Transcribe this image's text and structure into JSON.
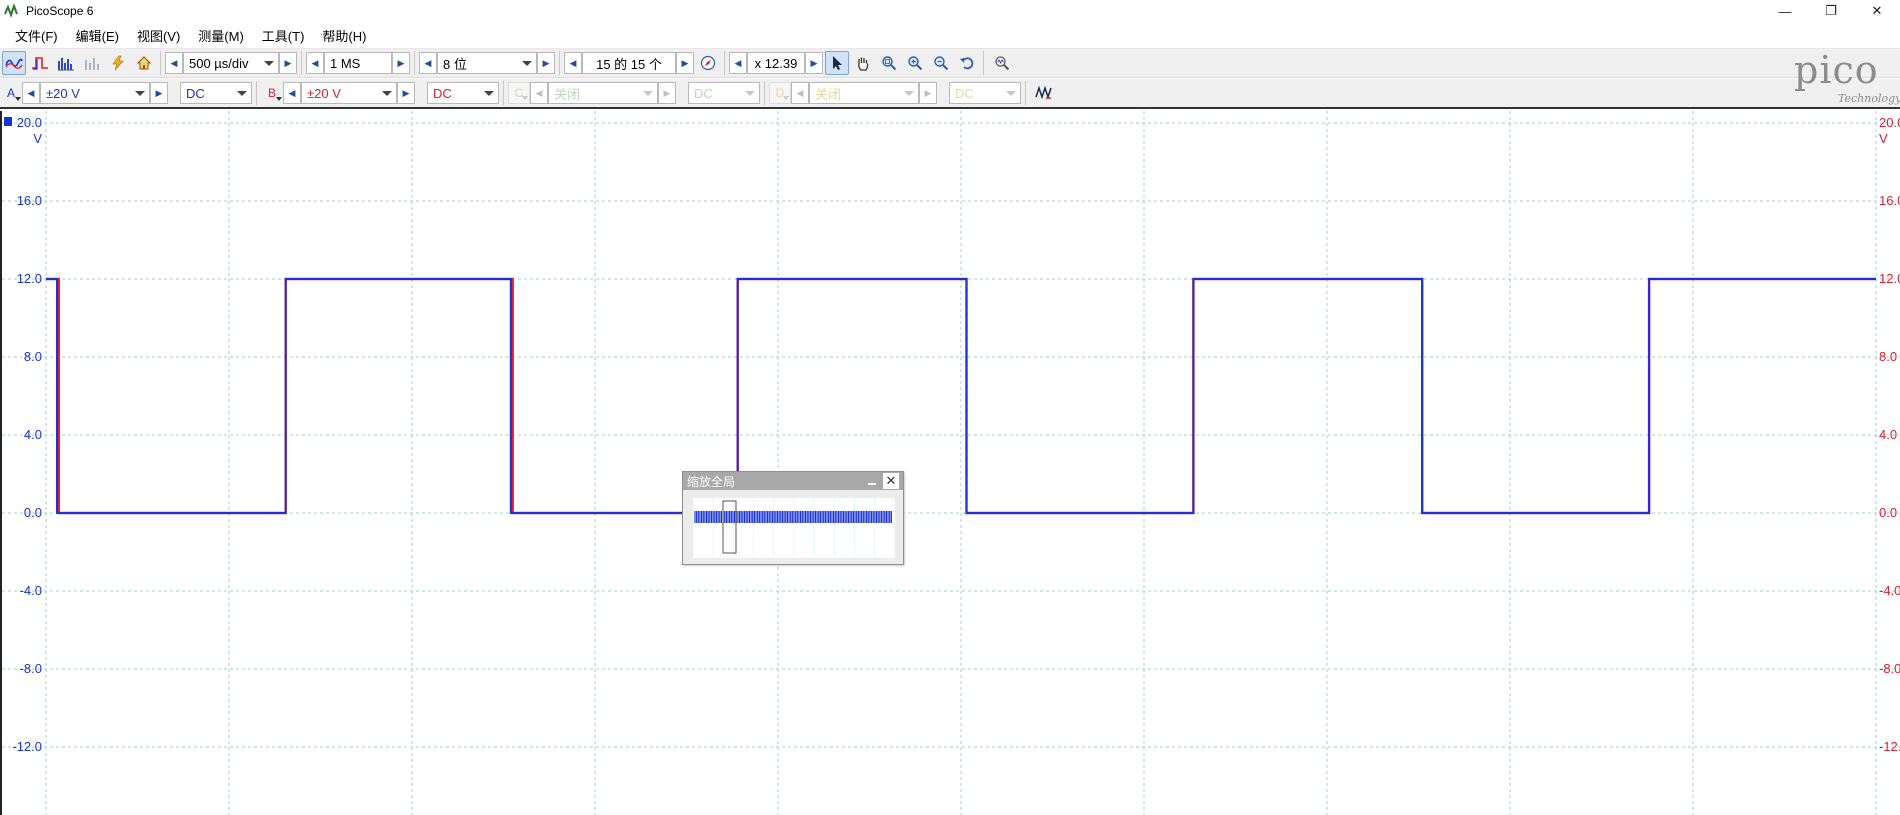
{
  "window": {
    "title": "PicoScope 6",
    "minimize": "—",
    "restore": "❐",
    "close": "✕"
  },
  "menu": [
    "文件(F)",
    "编辑(E)",
    "视图(V)",
    "测量(M)",
    "工具(T)",
    "帮助(H)"
  ],
  "toolbar": {
    "timebase": "500 µs/div",
    "samples": "1 MS",
    "resolution": "8 位",
    "buffer": "15 的 15 个",
    "zoom": "x 12.39"
  },
  "channels": [
    {
      "letter": "A",
      "range": "±20 V",
      "coupling": "DC",
      "color": "#1a33d9",
      "enabled": true
    },
    {
      "letter": "B",
      "range": "±20 V",
      "coupling": "DC",
      "color": "#e0202c",
      "enabled": true
    },
    {
      "letter": "C",
      "range": "关闭",
      "coupling": "DC",
      "color": "#7dc47d",
      "enabled": false
    },
    {
      "letter": "D",
      "range": "关闭",
      "coupling": "DC",
      "color": "#e8c060",
      "enabled": false
    }
  ],
  "logo": {
    "word": "pico",
    "sub": "Technology"
  },
  "overview": {
    "title": "缩放全局"
  },
  "axis": {
    "left_ticks": [
      "20.0",
      "16.0",
      "12.0",
      "8.0",
      "4.0",
      "0.0",
      "-4.0",
      "-8.0",
      "-12.0"
    ],
    "right_ticks": [
      "20.0",
      "16.0",
      "12.0",
      "8.0",
      "4.0",
      "0.0",
      "-4.0",
      "-8.0",
      "-12."
    ],
    "unit": "V"
  },
  "chart_data": {
    "type": "line",
    "title": "",
    "ylim": [
      -20,
      20
    ],
    "x_unit": "divisions",
    "xlim": [
      0,
      10
    ],
    "series": [
      {
        "name": "A",
        "color": "#1a33d9",
        "x": [
          0,
          0.06,
          0.06,
          1.31,
          1.31,
          2.54,
          2.54,
          3.78,
          3.78,
          5.03,
          5.03,
          6.27,
          6.27,
          7.52,
          7.52,
          8.76,
          8.76,
          10
        ],
        "values": [
          12,
          12,
          0,
          0,
          12,
          12,
          0,
          0,
          12,
          12,
          0,
          0,
          12,
          12,
          0,
          0,
          12,
          12
        ]
      },
      {
        "name": "B",
        "color": "#e0202c",
        "x": [
          0,
          0.07,
          0.07,
          1.31,
          1.31,
          2.55,
          2.55,
          3.78,
          3.78,
          5.03,
          5.03,
          6.27,
          6.27,
          7.52,
          7.52,
          8.76,
          8.76,
          10
        ],
        "values": [
          12,
          12,
          0,
          0,
          12,
          12,
          0,
          0,
          12,
          12,
          0,
          0,
          12,
          12,
          0,
          0,
          12,
          12
        ]
      }
    ]
  }
}
